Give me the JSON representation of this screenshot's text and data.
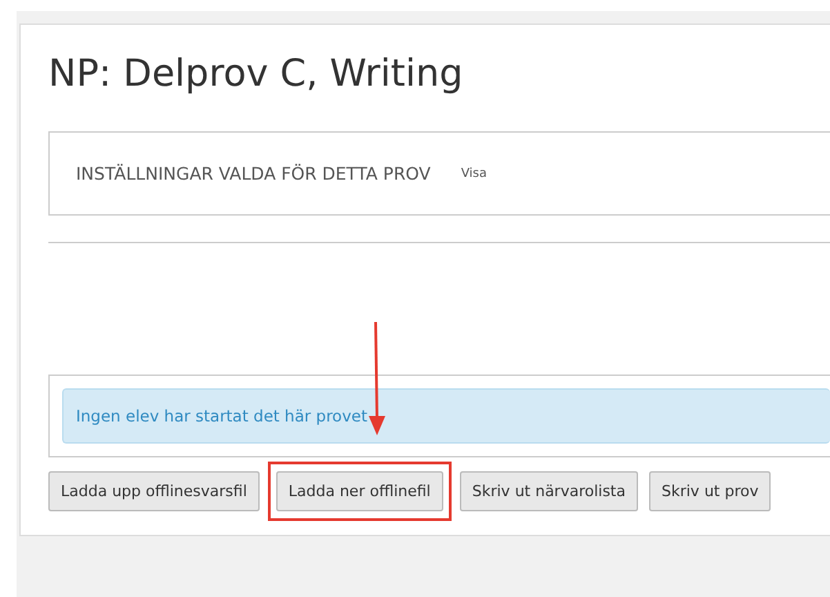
{
  "title": "NP: Delprov C, Writing",
  "settings": {
    "heading": "INSTÄLLNINGAR VALDA FÖR DETTA PROV",
    "link": "Visa"
  },
  "alert": {
    "text": "Ingen elev har startat det här provet"
  },
  "buttons": [
    {
      "label": "Ladda upp offlinesvarsfil",
      "highlighted": false
    },
    {
      "label": "Ladda ner offlinefil",
      "highlighted": true
    },
    {
      "label": "Skriv ut närvarolista",
      "highlighted": false
    },
    {
      "label": "Skriv ut prov",
      "highlighted": false
    }
  ]
}
